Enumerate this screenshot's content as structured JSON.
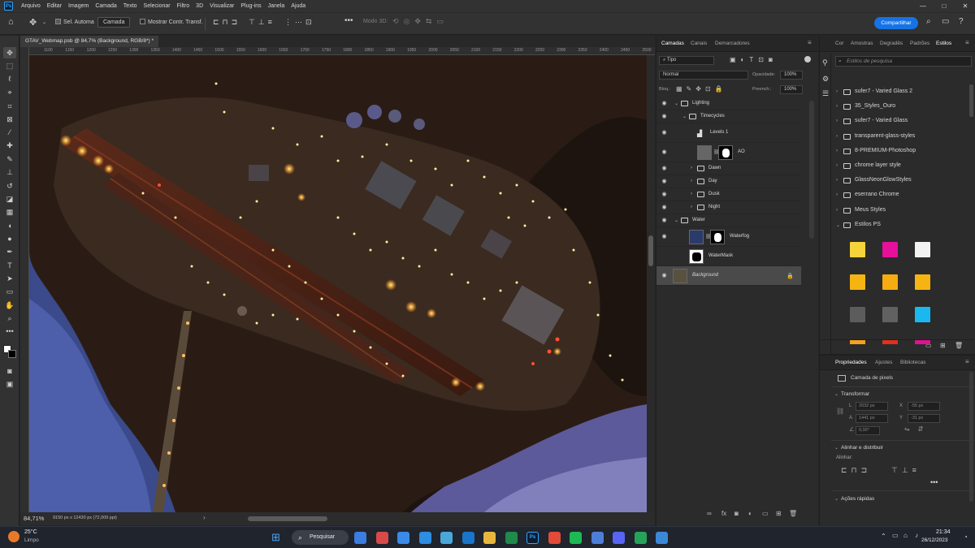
{
  "menu": {
    "items": [
      "Arquivo",
      "Editar",
      "Imagem",
      "Camada",
      "Texto",
      "Selecionar",
      "Filtro",
      "3D",
      "Visualizar",
      "Plug-ins",
      "Janela",
      "Ajuda"
    ],
    "ps_logo": "Ps"
  },
  "window_controls": [
    "—",
    "□",
    "✕"
  ],
  "options_bar": {
    "auto_select_label": "Sel. Automa",
    "auto_select_target": "Camada",
    "show_transform_label": "Mostrar Contr. Transf.",
    "mode_3d_label": "Modo 3D:",
    "share_button": "Compartilhar"
  },
  "document": {
    "tab_title": "GTAV_Webmap.psb @ 84,7% (Background, RGB/8*) *",
    "ruler_ticks": [
      "1100",
      "1150",
      "1200",
      "1250",
      "1300",
      "1350",
      "1400",
      "1450",
      "1500",
      "1550",
      "1600",
      "1650",
      "1700",
      "1750",
      "1800",
      "1850",
      "1900",
      "1950",
      "2000",
      "2050",
      "2100",
      "2150",
      "2200",
      "2250",
      "2300",
      "2350",
      "2400",
      "2450",
      "2500"
    ],
    "zoom": "84,71%",
    "size_info": "9150 px x 12430 px (72,009 ppi)"
  },
  "layers_panel": {
    "tabs": [
      "Camadas",
      "Canais",
      "Demarcadores"
    ],
    "filter_kind": "Tipo",
    "blend_mode": "Normal",
    "opacity_label": "Opacidade:",
    "opacity_value": "100%",
    "lock_label": "Bloq.:",
    "fill_label": "Preench.:",
    "fill_value": "100%",
    "layers": [
      {
        "name": "Lighting",
        "type": "group",
        "indent": 0,
        "visible": true,
        "expanded": true
      },
      {
        "name": "Timecycles",
        "type": "group",
        "indent": 1,
        "visible": true,
        "expanded": true
      },
      {
        "name": "Levels 1",
        "type": "adjustment",
        "indent": 2,
        "visible": true
      },
      {
        "name": "AO",
        "type": "masked",
        "indent": 2,
        "visible": true
      },
      {
        "name": "Dawn",
        "type": "group",
        "indent": 2,
        "visible": true,
        "expanded": false
      },
      {
        "name": "Day",
        "type": "group",
        "indent": 2,
        "visible": true,
        "expanded": false
      },
      {
        "name": "Dusk",
        "type": "group",
        "indent": 2,
        "visible": true,
        "expanded": false
      },
      {
        "name": "Night",
        "type": "group",
        "indent": 2,
        "visible": true,
        "expanded": false
      },
      {
        "name": "Water",
        "type": "group",
        "indent": 0,
        "visible": true,
        "expanded": true
      },
      {
        "name": "Waterfog",
        "type": "masked",
        "indent": 1,
        "visible": true
      },
      {
        "name": "WaterMask",
        "type": "pixel",
        "indent": 1,
        "visible": false
      },
      {
        "name": "Background",
        "type": "background",
        "indent": 0,
        "visible": true,
        "locked": true,
        "selected": true
      }
    ]
  },
  "styles_panel": {
    "tabs": [
      "Cor",
      "Amostras",
      "Degradês",
      "Padrões",
      "Estilos"
    ],
    "search_placeholder": "Estilos de pesquisa",
    "folders": [
      "sufer7 - Varied Glass 2",
      "35_Styles_Ouro",
      "sufer7 - Varied Glass",
      "transparent-glass-styles",
      "8-PREMIUM-Photoshop",
      "chrome layer style",
      "GlassNeonGlowStyles",
      "eserrano Chrome",
      "Meus Styles",
      "Estilos PS"
    ],
    "swatch_colors": [
      "#f5d33a",
      "#e6109a",
      "#f2f2f2",
      "#f5b412",
      "#f5ac10",
      "#f5b412",
      "#5c5c5c",
      "#616161",
      "#19b9f0"
    ]
  },
  "properties_panel": {
    "tabs": [
      "Propriedades",
      "Ajustes",
      "Bibliotecas"
    ],
    "layer_kind": "Camada de pixels",
    "transform_title": "Transformar",
    "w_label": "L",
    "w_value": "2032 px",
    "h_label": "A",
    "h_value": "1441 px",
    "x_label": "X",
    "x_value": "-55 px",
    "y_label": "Y",
    "y_value": "-31 px",
    "angle_value": "0,00°",
    "align_title": "Alinhar e distribuir",
    "align_sub": "Alinhar:",
    "quick_actions": "Ações rápidas"
  },
  "taskbar": {
    "weather_temp": "25°C",
    "weather_desc": "Limpo",
    "search_label": "Pesquisar",
    "time": "21:34",
    "date": "26/12/2023",
    "icon_colors": [
      "#3b7de0",
      "#d84a4a",
      "#3a8be8",
      "#2d8de0",
      "#4aa8d8",
      "#1a74c9",
      "#e7b73d",
      "#1f8a4c",
      "#0b1d33",
      "#e04b3a",
      "#1db954",
      "#4e7fd8",
      "#5865f2",
      "#26a35a",
      "#3b88d8"
    ]
  }
}
